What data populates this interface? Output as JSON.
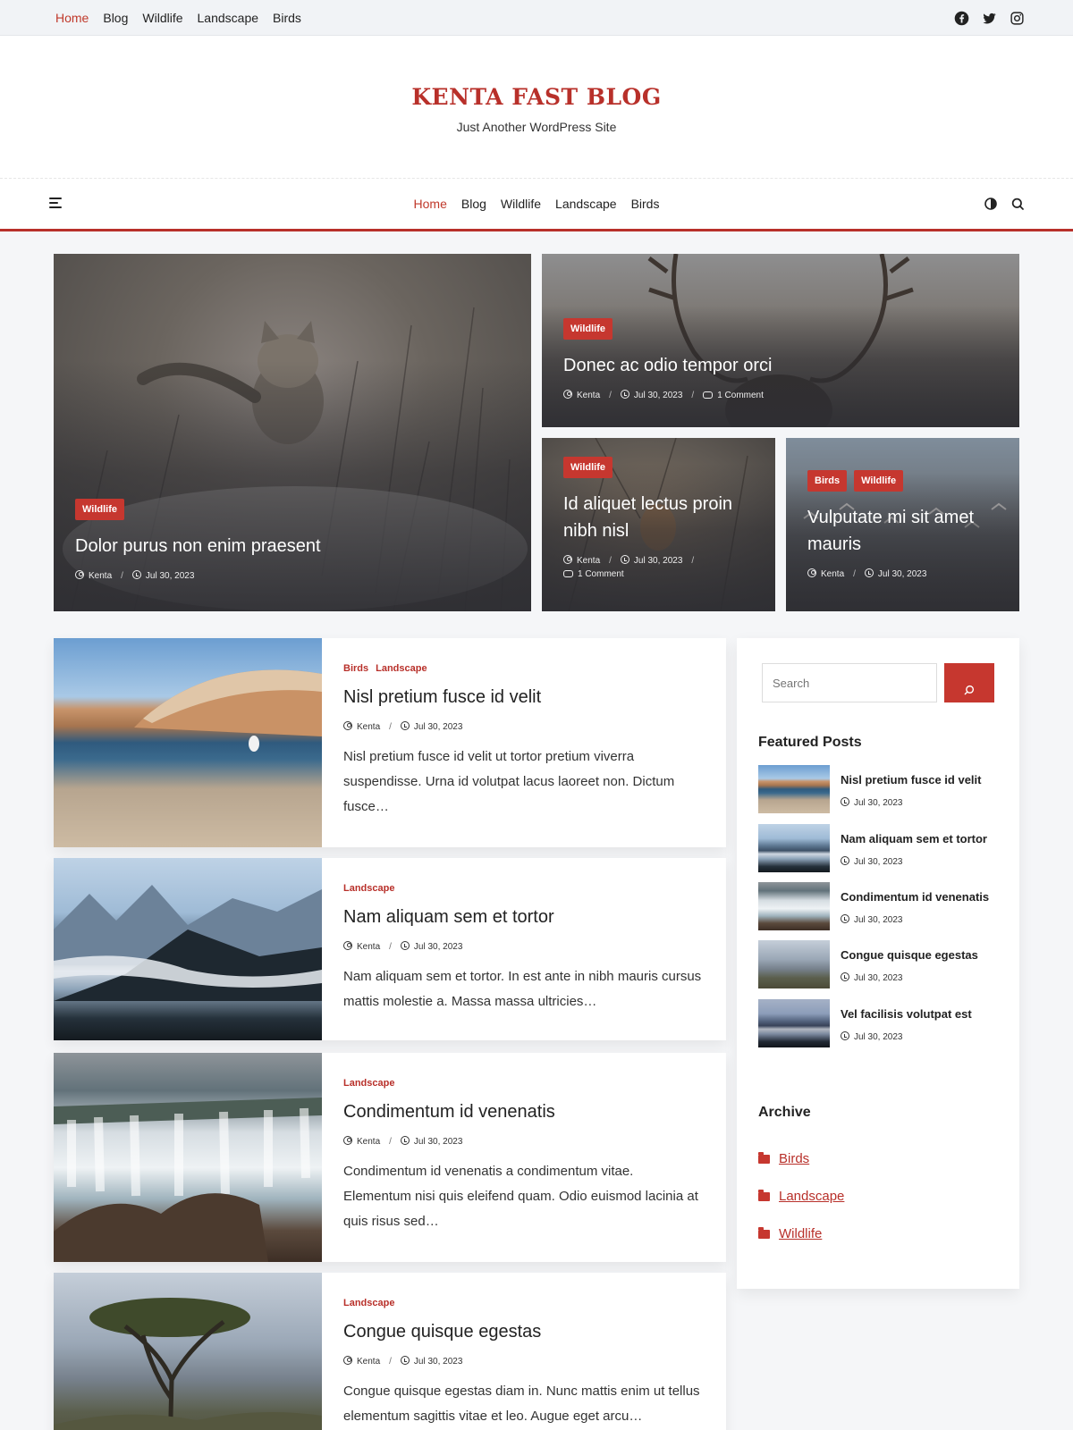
{
  "topbar": {
    "nav": [
      "Home",
      "Blog",
      "Wildlife",
      "Landscape",
      "Birds"
    ],
    "social_icons": [
      "facebook-icon",
      "twitter-icon",
      "instagram-icon"
    ]
  },
  "header": {
    "title": "KENTA FAST BLOG",
    "tagline": "Just Another WordPress Site"
  },
  "mainnav": {
    "items": [
      "Home",
      "Blog",
      "Wildlife",
      "Landscape",
      "Birds"
    ],
    "active": "Home"
  },
  "hero": [
    {
      "badges": [
        "Wildlife"
      ],
      "title": "Dolor purus non enim praesent",
      "author": "Kenta",
      "date": "Jul 30, 2023",
      "comments": ""
    },
    {
      "badges": [
        "Wildlife"
      ],
      "title": "Donec ac odio tempor orci",
      "author": "Kenta",
      "date": "Jul 30, 2023",
      "comments": "1 Comment"
    },
    {
      "badges": [
        "Wildlife"
      ],
      "title": "Id aliquet lectus proin nibh nisl",
      "author": "Kenta",
      "date": "Jul 30, 2023",
      "comments": "1 Comment"
    },
    {
      "badges": [
        "Birds",
        "Wildlife"
      ],
      "title": "Vulputate mi sit amet mauris",
      "author": "Kenta",
      "date": "Jul 30, 2023",
      "comments": ""
    }
  ],
  "posts": [
    {
      "cats": [
        "Birds",
        "Landscape"
      ],
      "title": "Nisl pretium fusce id velit",
      "author": "Kenta",
      "date": "Jul 30, 2023",
      "excerpt": "Nisl pretium fusce id velit ut tortor pretium viverra suspendisse. Urna id volutpat lacus laoreet non. Dictum fusce…"
    },
    {
      "cats": [
        "Landscape"
      ],
      "title": "Nam aliquam sem et tortor",
      "author": "Kenta",
      "date": "Jul 30, 2023",
      "excerpt": "Nam aliquam sem et tortor. In est ante in nibh mauris cursus mattis molestie a. Massa massa ultricies…"
    },
    {
      "cats": [
        "Landscape"
      ],
      "title": "Condimentum id venenatis",
      "author": "Kenta",
      "date": "Jul 30, 2023",
      "excerpt": "Condimentum id venenatis a condimentum vitae. Elementum nisi quis eleifend quam. Odio euismod lacinia at quis risus sed…"
    },
    {
      "cats": [
        "Landscape"
      ],
      "title": "Congue quisque egestas",
      "author": "Kenta",
      "date": "Jul 30, 2023",
      "excerpt": "Congue quisque egestas diam in. Nunc mattis enim ut tellus elementum sagittis vitae et leo. Augue eget arcu…"
    }
  ],
  "sidebar": {
    "search_placeholder": "Search",
    "featured_title": "Featured Posts",
    "featured": [
      {
        "title": "Nisl pretium fusce id velit",
        "date": "Jul 30, 2023"
      },
      {
        "title": "Nam aliquam sem et tortor",
        "date": "Jul 30, 2023"
      },
      {
        "title": "Condimentum id venenatis",
        "date": "Jul 30, 2023"
      },
      {
        "title": "Congue quisque egestas",
        "date": "Jul 30, 2023"
      },
      {
        "title": "Vel facilisis volutpat est",
        "date": "Jul 30, 2023"
      }
    ],
    "archive_title": "Archive",
    "archive": [
      "Birds",
      "Landscape",
      "Wildlife"
    ]
  },
  "colors": {
    "accent": "#c6372f",
    "title": "#b8302a",
    "topbar_bg": "#f1f3f6"
  }
}
